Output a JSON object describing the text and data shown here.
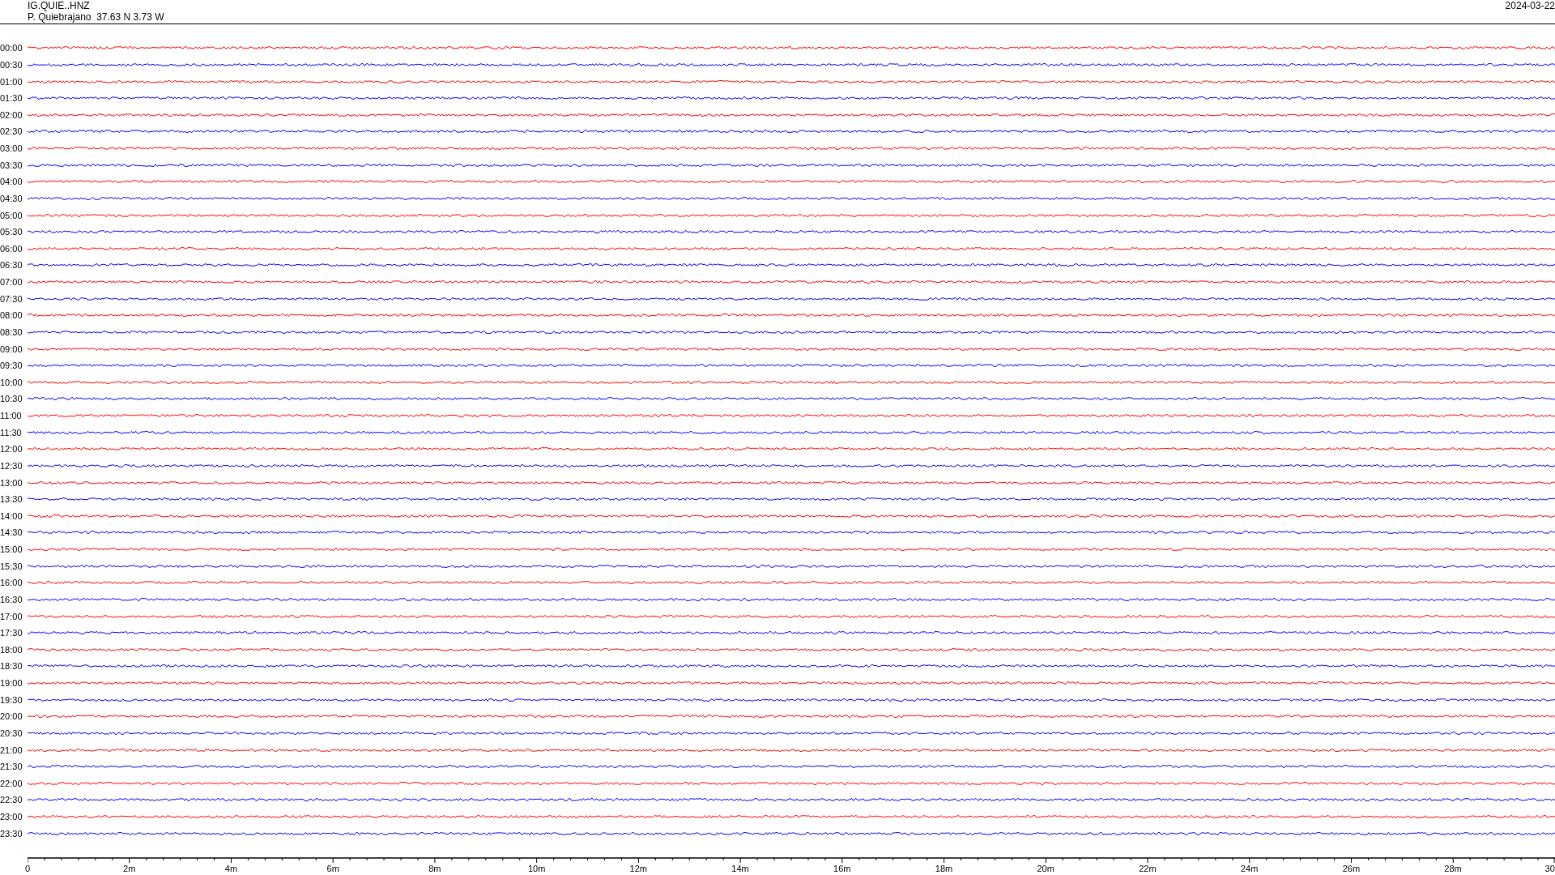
{
  "header": {
    "station": "IG.QUIE..HNZ",
    "location": "P. Quiebrajano  37.63 N 3.73 W",
    "date": "2024-03-22"
  },
  "traces": [
    {
      "time": "00:00",
      "color": "#ff0000"
    },
    {
      "time": "00:30",
      "color": "#0000ff"
    },
    {
      "time": "01:00",
      "color": "#ff0000"
    },
    {
      "time": "01:30",
      "color": "#0000ff"
    },
    {
      "time": "02:00",
      "color": "#ff0000"
    },
    {
      "time": "02:30",
      "color": "#0000ff"
    },
    {
      "time": "03:00",
      "color": "#ff0000"
    },
    {
      "time": "03:30",
      "color": "#0000ff"
    },
    {
      "time": "04:00",
      "color": "#ff0000"
    },
    {
      "time": "04:30",
      "color": "#0000ff"
    },
    {
      "time": "05:00",
      "color": "#ff0000"
    },
    {
      "time": "05:30",
      "color": "#0000ff"
    },
    {
      "time": "06:00",
      "color": "#ff0000"
    },
    {
      "time": "06:30",
      "color": "#0000ff"
    },
    {
      "time": "07:00",
      "color": "#ff0000"
    },
    {
      "time": "07:30",
      "color": "#0000ff"
    },
    {
      "time": "08:00",
      "color": "#ff0000"
    },
    {
      "time": "08:30",
      "color": "#0000ff"
    },
    {
      "time": "09:00",
      "color": "#ff0000"
    },
    {
      "time": "09:30",
      "color": "#0000ff"
    },
    {
      "time": "10:00",
      "color": "#ff0000"
    },
    {
      "time": "10:30",
      "color": "#0000ff"
    },
    {
      "time": "11:00",
      "color": "#ff0000"
    },
    {
      "time": "11:30",
      "color": "#0000ff"
    },
    {
      "time": "12:00",
      "color": "#ff0000"
    },
    {
      "time": "12:30",
      "color": "#0000ff"
    },
    {
      "time": "13:00",
      "color": "#ff0000"
    },
    {
      "time": "13:30",
      "color": "#0000ff"
    },
    {
      "time": "14:00",
      "color": "#ff0000"
    },
    {
      "time": "14:30",
      "color": "#0000ff"
    },
    {
      "time": "15:00",
      "color": "#ff0000"
    },
    {
      "time": "15:30",
      "color": "#0000ff"
    },
    {
      "time": "16:00",
      "color": "#ff0000"
    },
    {
      "time": "16:30",
      "color": "#0000ff"
    },
    {
      "time": "17:00",
      "color": "#ff0000"
    },
    {
      "time": "17:30",
      "color": "#0000ff"
    },
    {
      "time": "18:00",
      "color": "#ff0000"
    },
    {
      "time": "18:30",
      "color": "#0000ff"
    },
    {
      "time": "19:00",
      "color": "#ff0000"
    },
    {
      "time": "19:30",
      "color": "#0000ff"
    },
    {
      "time": "20:00",
      "color": "#ff0000"
    },
    {
      "time": "20:30",
      "color": "#0000ff"
    },
    {
      "time": "21:00",
      "color": "#ff0000"
    },
    {
      "time": "21:30",
      "color": "#0000ff"
    },
    {
      "time": "22:00",
      "color": "#ff0000"
    },
    {
      "time": "22:30",
      "color": "#0000ff"
    },
    {
      "time": "23:00",
      "color": "#ff0000"
    },
    {
      "time": "23:30",
      "color": "#0000ff"
    }
  ],
  "x_axis": {
    "labels": [
      "0",
      "2m",
      "4m",
      "6m",
      "8m",
      "10m",
      "12m",
      "14m",
      "16m",
      "18m",
      "20m",
      "22m",
      "24m",
      "26m",
      "28m",
      "30"
    ]
  }
}
